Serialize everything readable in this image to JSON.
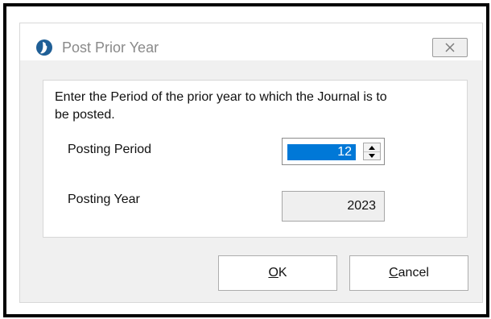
{
  "window": {
    "title": "Post Prior Year",
    "close_icon": "close-icon",
    "app_icon": "app-logo-icon"
  },
  "content": {
    "instruction": "Enter the Period of the prior year to which the Journal is to be posted.",
    "posting_period_label": "Posting Period",
    "posting_period_value": "12",
    "posting_year_label": "Posting Year",
    "posting_year_value": "2023"
  },
  "buttons": {
    "ok": {
      "mnemonic": "O",
      "rest": "K"
    },
    "cancel": {
      "mnemonic": "C",
      "rest": "ancel"
    }
  },
  "colors": {
    "selection": "#0078d7",
    "dialog_background": "#f0f0f0",
    "panel_background": "#ffffff",
    "title_text": "#8a8a8a"
  }
}
